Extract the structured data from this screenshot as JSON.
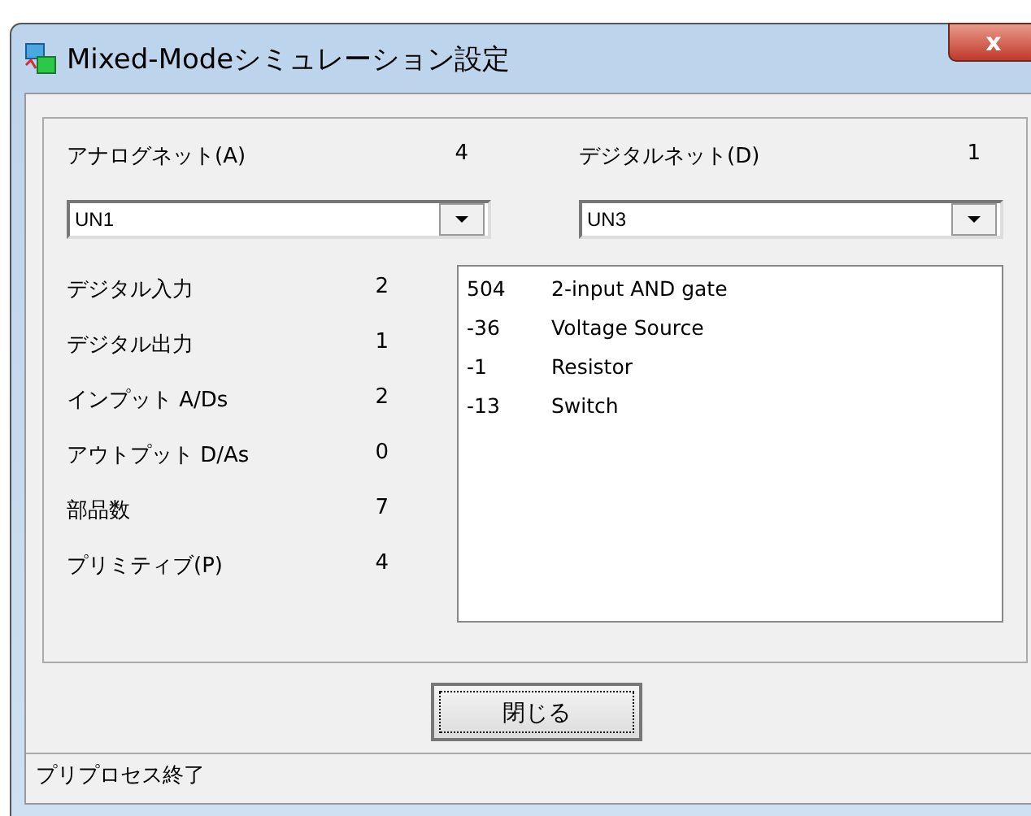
{
  "window": {
    "title": "Mixed-Modeシミュレーション設定",
    "close": "x"
  },
  "analog_net": {
    "label": "アナログネット(A)",
    "count": "4",
    "value": "UN1"
  },
  "digital_net": {
    "label": "デジタルネット(D)",
    "count": "1",
    "value": "UN3"
  },
  "stats": [
    {
      "label": "デジタル入力",
      "value": "2"
    },
    {
      "label": "デジタル出力",
      "value": "1"
    },
    {
      "label": "インプット A/Ds",
      "value": "2"
    },
    {
      "label": "アウトプット D/As",
      "value": "0"
    },
    {
      "label": "部品数",
      "value": "7"
    },
    {
      "label": "プリミティブ(P)",
      "value": "4"
    }
  ],
  "parts": [
    {
      "id": "504",
      "name": "2-input AND gate"
    },
    {
      "id": "-36",
      "name": "Voltage Source"
    },
    {
      "id": "-1",
      "name": "Resistor"
    },
    {
      "id": "-13",
      "name": "Switch"
    }
  ],
  "buttons": [
    "閉じる"
  ],
  "status_bar": "プリプロセス終了"
}
